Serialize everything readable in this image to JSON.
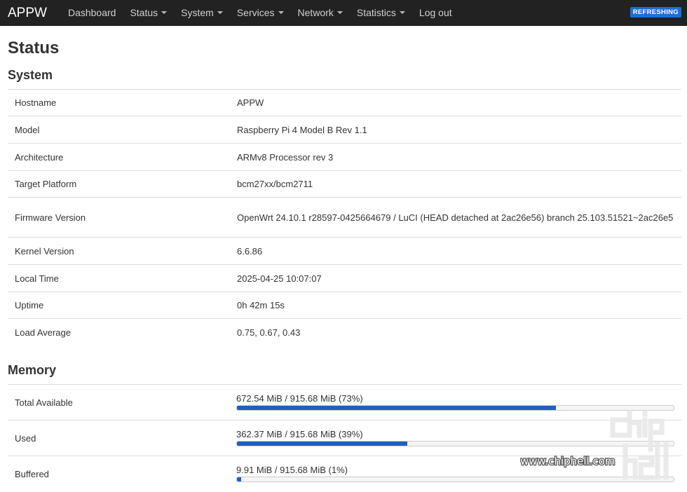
{
  "navbar": {
    "brand": "APPW",
    "items": [
      {
        "label": "Dashboard",
        "dropdown": false
      },
      {
        "label": "Status",
        "dropdown": true
      },
      {
        "label": "System",
        "dropdown": true
      },
      {
        "label": "Services",
        "dropdown": true
      },
      {
        "label": "Network",
        "dropdown": true
      },
      {
        "label": "Statistics",
        "dropdown": true
      },
      {
        "label": "Log out",
        "dropdown": false
      }
    ],
    "badge": "REFRESHING"
  },
  "page_title": "Status",
  "system": {
    "heading": "System",
    "rows": [
      {
        "key": "Hostname",
        "value": "APPW"
      },
      {
        "key": "Model",
        "value": "Raspberry Pi 4 Model B Rev 1.1"
      },
      {
        "key": "Architecture",
        "value": "ARMv8 Processor rev 3"
      },
      {
        "key": "Target Platform",
        "value": "bcm27xx/bcm2711"
      },
      {
        "key": "Firmware Version",
        "value": "OpenWrt 24.10.1 r28597-0425664679 / LuCI (HEAD detached at 2ac26e56) branch 25.103.51521~2ac26e5"
      },
      {
        "key": "Kernel Version",
        "value": "6.6.86"
      },
      {
        "key": "Local Time",
        "value": "2025-04-25 10:07:07"
      },
      {
        "key": "Uptime",
        "value": "0h 42m 15s"
      },
      {
        "key": "Load Average",
        "value": "0.75, 0.67, 0.43"
      }
    ]
  },
  "memory": {
    "heading": "Memory",
    "rows": [
      {
        "key": "Total Available",
        "value": "672.54 MiB / 915.68 MiB (73%)",
        "percent": 73
      },
      {
        "key": "Used",
        "value": "362.37 MiB / 915.68 MiB (39%)",
        "percent": 39
      },
      {
        "key": "Buffered",
        "value": "9.91 MiB / 915.68 MiB (1%)",
        "percent": 1
      }
    ]
  },
  "watermark": {
    "text": "www.chiphell.com",
    "logo": "chip hell"
  }
}
